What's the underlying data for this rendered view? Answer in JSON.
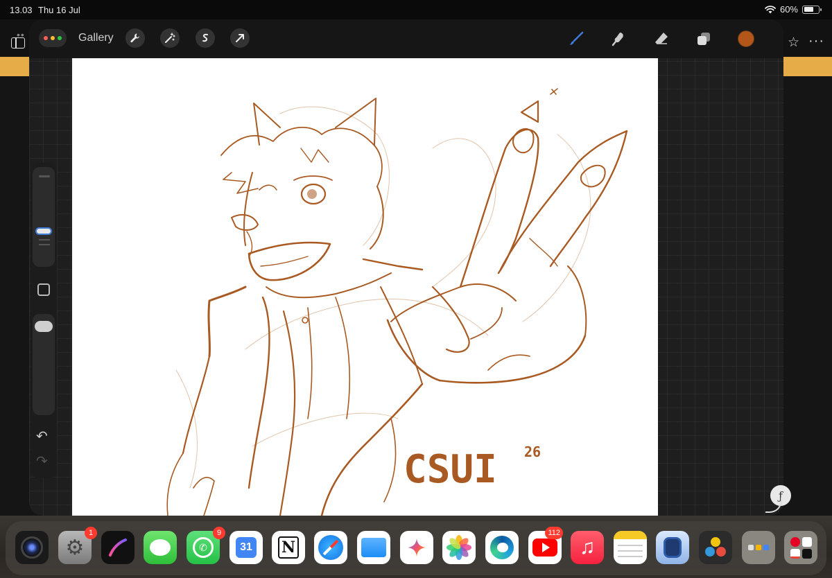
{
  "status_bar": {
    "time": "13.03",
    "date": "Thu 16 Jul",
    "battery": "60%"
  },
  "toolbar": {
    "gallery_label": "Gallery",
    "left_tools": [
      "wrench-icon",
      "magic-wand-icon",
      "selection-icon",
      "transform-arrow-icon"
    ],
    "right_tools": [
      "brush-icon",
      "smudge-icon",
      "eraser-icon",
      "layers-icon"
    ],
    "active_color": "#b2561a"
  },
  "canvas": {
    "signature": "CSUI",
    "signature_sup": "26"
  },
  "colors": {
    "accent_blue": "#3f7bd9",
    "sketch_brown": "#a85a22",
    "bg_band": "#e6ac47"
  },
  "dock": {
    "apps": [
      {
        "name": "camera-app",
        "badge": ""
      },
      {
        "name": "settings-app",
        "badge": "1"
      },
      {
        "name": "procreate-app",
        "badge": ""
      },
      {
        "name": "messages-app",
        "badge": ""
      },
      {
        "name": "whatsapp-app",
        "badge": "9"
      },
      {
        "name": "calendar-app",
        "badge": "",
        "text": "31"
      },
      {
        "name": "notion-app",
        "badge": "",
        "text": "N"
      },
      {
        "name": "safari-app",
        "badge": ""
      },
      {
        "name": "files-app",
        "badge": ""
      },
      {
        "name": "gemini-app",
        "badge": ""
      },
      {
        "name": "photos-app",
        "badge": ""
      },
      {
        "name": "edge-app",
        "badge": ""
      },
      {
        "name": "youtube-app",
        "badge": "112"
      },
      {
        "name": "music-app",
        "badge": ""
      },
      {
        "name": "notes-app",
        "badge": ""
      },
      {
        "name": "clipper-app",
        "badge": ""
      },
      {
        "name": "davinci-app",
        "badge": ""
      },
      {
        "name": "folder-app",
        "badge": ""
      },
      {
        "name": "recent-apps-folder",
        "badge": ""
      }
    ]
  }
}
